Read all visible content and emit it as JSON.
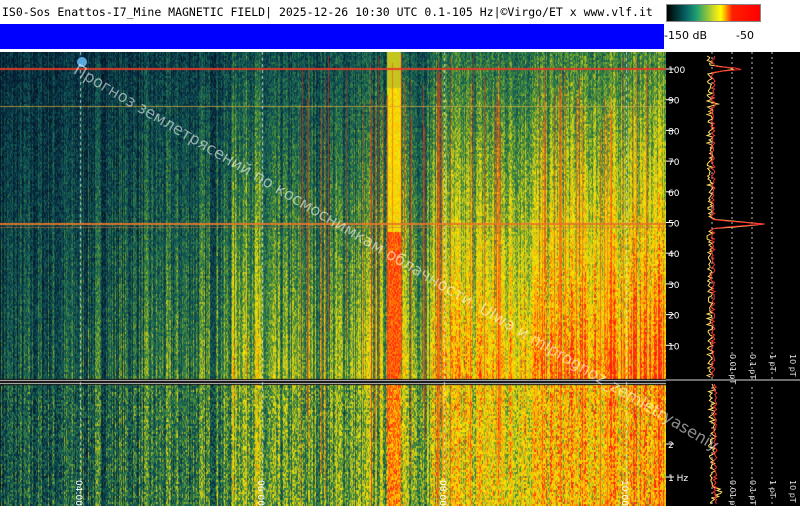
{
  "header": {
    "title": "IS0-Sos Enattos-I7_Mine MAGNETIC FIELD| 2025-12-26 10:30 UTC 0.1-105 Hz|©Virgo/ET x www.vlf.it"
  },
  "colorbar": {
    "min_label": "-150 dB",
    "max_label": "-50"
  },
  "upper_axis": {
    "ticks": [
      "100",
      "90",
      "80",
      "70",
      "60",
      "50",
      "40",
      "30",
      "20",
      "10"
    ],
    "tick_values": [
      100,
      90,
      80,
      70,
      60,
      50,
      40,
      30,
      20,
      10
    ]
  },
  "lower_axis": {
    "ticks": [
      "2",
      "1 Hz"
    ],
    "tick_values": [
      2,
      1
    ]
  },
  "time_axis": {
    "labels": [
      "04:00",
      "06:00",
      "08:00",
      "10:00"
    ]
  },
  "spectrum_scale": {
    "upper_labels": [
      "0.01 pT",
      "0.1 pT",
      "1 pT",
      "10 pT"
    ],
    "lower_labels": [
      "0.01 pT",
      "0.1 pT",
      "1 pT",
      "10 pT"
    ]
  },
  "watermark": {
    "text": "Прогноз землетрясений по космоснимкам облачности. Ulwa и mlprognoz_zemletryaseniy"
  },
  "colors": {
    "blue_bar": "#0000ff",
    "red_line": "#ff2020",
    "background": "#000000"
  }
}
